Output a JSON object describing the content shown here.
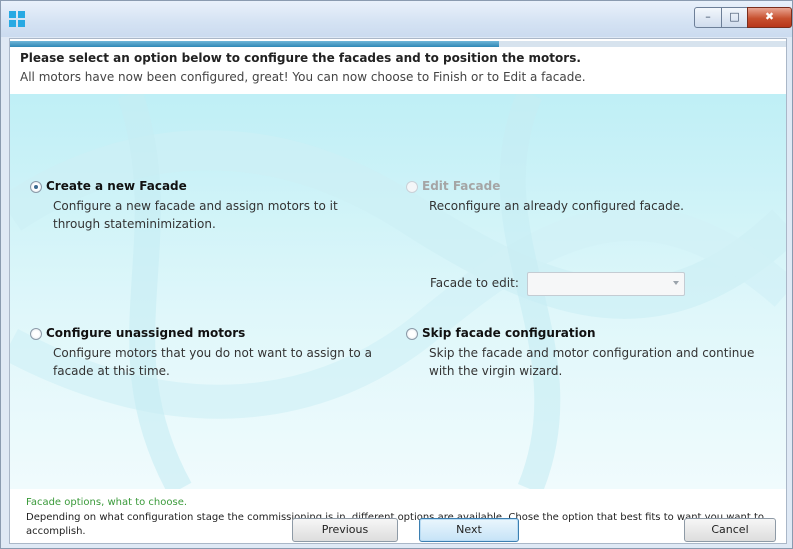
{
  "window": {
    "minimize_label": "–",
    "maximize_label": "□",
    "close_label": "✖"
  },
  "progress": {
    "value_percent": 63
  },
  "header": {
    "title": "Please select an option below to configure the facades and to position the motors.",
    "subtitle": "All motors have now been configured, great! You can now choose to Finish or to Edit a facade."
  },
  "options": [
    {
      "title": "Create a new Facade",
      "description_lines": [
        "Configure a new facade and assign motors to it",
        "through stateminimization."
      ],
      "checked": true,
      "enabled": true
    },
    {
      "title": "Edit Facade",
      "description_lines": [
        "Reconfigure an already configured facade."
      ],
      "checked": false,
      "enabled": false
    },
    {
      "title": "Configure unassigned motors",
      "description_lines": [
        "Configure motors that you do not want to assign to a",
        "facade at this time."
      ],
      "checked": false,
      "enabled": true
    },
    {
      "title": "Skip facade configuration",
      "description_lines": [
        "Skip the facade and motor configuration and continue",
        "with the virgin wizard."
      ],
      "checked": false,
      "enabled": true
    }
  ],
  "edit_facade": {
    "label": "Facade to edit:",
    "selected_value": ""
  },
  "info": {
    "title": "Facade options, what to choose.",
    "text": "Depending on what configuration stage the commissioning is in, different options are available. Chose the option that best fits to want you want to accomplish."
  },
  "buttons": {
    "previous": "Previous",
    "next": "Next",
    "cancel": "Cancel"
  },
  "colors": {
    "accent": "#2f88b6",
    "info_title": "#3a9a3a",
    "background_top": "#bfeff6"
  },
  "icons": {
    "app": "windows-tile-icon",
    "dropdown": "chevron-down-icon"
  }
}
